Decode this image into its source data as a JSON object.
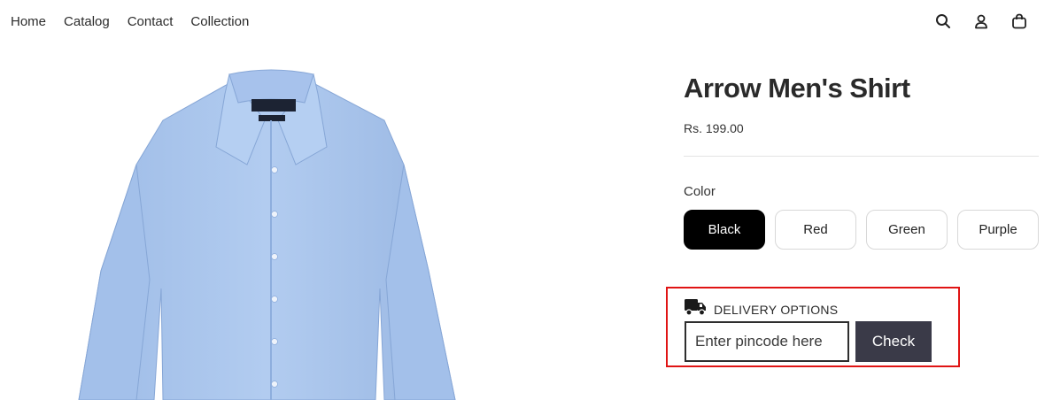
{
  "nav": {
    "items": [
      {
        "label": "Home"
      },
      {
        "label": "Catalog"
      },
      {
        "label": "Contact"
      },
      {
        "label": "Collection"
      }
    ]
  },
  "header_icons": [
    "search-icon",
    "account-icon",
    "cart-icon"
  ],
  "product": {
    "title": "Arrow Men's Shirt",
    "price": "Rs. 199.00",
    "image_icon": "shirt-image"
  },
  "color": {
    "label": "Color",
    "options": [
      {
        "label": "Black",
        "selected": true
      },
      {
        "label": "Red",
        "selected": false
      },
      {
        "label": "Green",
        "selected": false
      },
      {
        "label": "Purple",
        "selected": false
      }
    ]
  },
  "delivery": {
    "heading": "DELIVERY OPTIONS",
    "icon": "truck-icon",
    "input_placeholder": "Enter pincode here",
    "input_value": "",
    "button_label": "Check",
    "highlight_color": "#e01414"
  },
  "colors": {
    "button_dark": "#3a3a48",
    "selected_swatch": "#000000",
    "shirt": "#a9c4ea"
  }
}
